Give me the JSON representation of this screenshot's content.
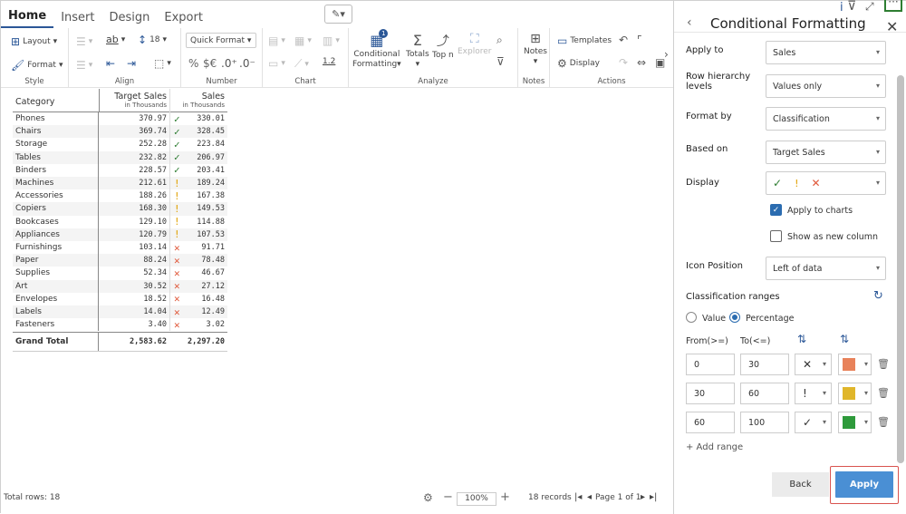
{
  "tabs": [
    {
      "label": "Home",
      "active": true
    },
    {
      "label": "Insert"
    },
    {
      "label": "Design"
    },
    {
      "label": "Export"
    }
  ],
  "ribbon": {
    "style": {
      "label": "Style",
      "layout": "Layout",
      "format": "Format"
    },
    "align": {
      "label": "Align",
      "font_size": "18",
      "ab": "ab"
    },
    "number": {
      "label": "Number",
      "quick_format": "Quick Format",
      "pct": "%",
      "currency": "$€",
      "inc": ".0⁺",
      "dec": ".0⁻"
    },
    "chart": {
      "label": "Chart",
      "scale": "1.2"
    },
    "analyze": {
      "label": "Analyze",
      "conditional": "Conditional",
      "formatting": "Formatting",
      "totals": "Totals",
      "top_n": "Top n",
      "explorer": "Explorer",
      "badge": "1"
    },
    "notes": {
      "label": "Notes",
      "notes": "Notes"
    },
    "actions": {
      "label": "Actions",
      "templates": "Templates",
      "display": "Display"
    }
  },
  "table": {
    "col_category": "Category",
    "col_target": "Target Sales",
    "col_target_sub": "in Thousands",
    "col_sales": "Sales",
    "col_sales_sub": "in Thousands",
    "rows": [
      {
        "category": "Phones",
        "target": "370.97",
        "flag": "check",
        "sales": "330.01"
      },
      {
        "category": "Chairs",
        "target": "369.74",
        "flag": "check",
        "sales": "328.45"
      },
      {
        "category": "Storage",
        "target": "252.28",
        "flag": "check",
        "sales": "223.84"
      },
      {
        "category": "Tables",
        "target": "232.82",
        "flag": "check",
        "sales": "206.97"
      },
      {
        "category": "Binders",
        "target": "228.57",
        "flag": "check",
        "sales": "203.41"
      },
      {
        "category": "Machines",
        "target": "212.61",
        "flag": "excl",
        "sales": "189.24"
      },
      {
        "category": "Accessories",
        "target": "188.26",
        "flag": "excl",
        "sales": "167.38"
      },
      {
        "category": "Copiers",
        "target": "168.30",
        "flag": "excl",
        "sales": "149.53"
      },
      {
        "category": "Bookcases",
        "target": "129.10",
        "flag": "excl",
        "sales": "114.88"
      },
      {
        "category": "Appliances",
        "target": "120.79",
        "flag": "excl",
        "sales": "107.53"
      },
      {
        "category": "Furnishings",
        "target": "103.14",
        "flag": "cross",
        "sales": "91.71"
      },
      {
        "category": "Paper",
        "target": "88.24",
        "flag": "cross",
        "sales": "78.48"
      },
      {
        "category": "Supplies",
        "target": "52.34",
        "flag": "cross",
        "sales": "46.67"
      },
      {
        "category": "Art",
        "target": "30.52",
        "flag": "cross",
        "sales": "27.12"
      },
      {
        "category": "Envelopes",
        "target": "18.52",
        "flag": "cross",
        "sales": "16.48"
      },
      {
        "category": "Labels",
        "target": "14.04",
        "flag": "cross",
        "sales": "12.49"
      },
      {
        "category": "Fasteners",
        "target": "3.40",
        "flag": "cross",
        "sales": "3.02"
      }
    ],
    "grand_total_label": "Grand Total",
    "grand_total_target": "2,583.62",
    "grand_total_sales": "2,297.20"
  },
  "flags": {
    "check": "✓",
    "excl": "!",
    "cross": "✕"
  },
  "colors": {
    "check": "#2e7d32",
    "excl": "#e0a000",
    "cross": "#e0583a",
    "accent": "#2b5797",
    "orange": "#e8825a",
    "yellow": "#e0b62a",
    "green": "#2e9a3b"
  },
  "status": {
    "total_rows": "Total rows: 18",
    "zoom": "100%",
    "records": "18 records",
    "page": "Page 1 of 1"
  },
  "panel": {
    "title": "Conditional Formatting",
    "apply_to_label": "Apply to",
    "apply_to_value": "Sales",
    "row_hier_label1": "Row hierarchy",
    "row_hier_label2": "levels",
    "row_hier_value": "Values only",
    "format_by_label": "Format by",
    "format_by_value": "Classification",
    "based_on_label": "Based on",
    "based_on_value": "Target Sales",
    "display_label": "Display",
    "apply_charts": "Apply to charts",
    "show_new_col": "Show as new column",
    "icon_pos_label": "Icon Position",
    "icon_pos_value": "Left of data",
    "ranges_label": "Classification ranges",
    "opt_value": "Value",
    "opt_percentage": "Percentage",
    "from_label": "From(>=)",
    "to_label": "To(<=)",
    "ranges": [
      {
        "from": "0",
        "to": "30",
        "icon": "✕",
        "color": "#e8825a"
      },
      {
        "from": "30",
        "to": "60",
        "icon": "!",
        "color": "#e0b62a"
      },
      {
        "from": "60",
        "to": "100",
        "icon": "✓",
        "color": "#2e9a3b"
      }
    ],
    "add_range": "+ Add range",
    "back": "Back",
    "apply": "Apply"
  }
}
